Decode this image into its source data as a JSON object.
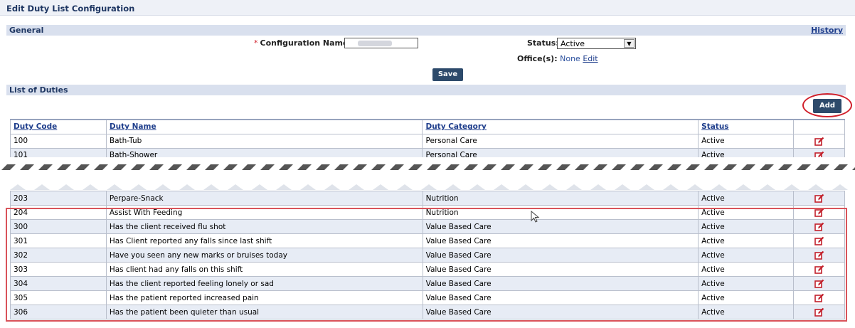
{
  "page": {
    "title": "Edit Duty List Configuration"
  },
  "general": {
    "section_label": "General",
    "history_label": "History",
    "config_name_label": "Configuration Name:",
    "required_mark": "*",
    "status_label": "Status:",
    "status_value": "Active",
    "offices_label": "Office(s):",
    "offices_value": "None",
    "offices_edit_label": "Edit",
    "save_label": "Save"
  },
  "duties": {
    "section_label": "List of Duties",
    "add_label": "Add",
    "columns": [
      "Duty Code",
      "Duty Name",
      "Duty Category",
      "Status"
    ],
    "rows_top": [
      {
        "code": "100",
        "name": "Bath-Tub",
        "category": "Personal Care",
        "status": "Active"
      },
      {
        "code": "101",
        "name": "Bath-Shower",
        "category": "Personal Care",
        "status": "Active"
      }
    ],
    "rows_bottom": [
      {
        "code": "203",
        "name": "Perpare-Snack",
        "category": "Nutrition",
        "status": "Active"
      },
      {
        "code": "204",
        "name": "Assist With Feeding",
        "category": "Nutrition",
        "status": "Active"
      },
      {
        "code": "300",
        "name": "Has the client received flu shot",
        "category": "Value Based Care",
        "status": "Active"
      },
      {
        "code": "301",
        "name": "Has Client reported any falls since last shift",
        "category": "Value Based Care",
        "status": "Active"
      },
      {
        "code": "302",
        "name": "Have you seen any new marks or bruises today",
        "category": "Value Based Care",
        "status": "Active"
      },
      {
        "code": "303",
        "name": "Has client had any falls on this shift",
        "category": "Value Based Care",
        "status": "Active"
      },
      {
        "code": "304",
        "name": "Has the client reported feeling lonely or sad",
        "category": "Value Based Care",
        "status": "Active"
      },
      {
        "code": "305",
        "name": "Has the patient reported increased pain",
        "category": "Value Based Care",
        "status": "Active"
      },
      {
        "code": "306",
        "name": "Has the patient been quieter than usual",
        "category": "Value Based Care",
        "status": "Active"
      }
    ]
  },
  "colors": {
    "accent": "#1f3e8c",
    "section_bg": "#d9e0ee",
    "button_bg": "#2d4a6b",
    "highlight_red": "#d1202b",
    "row_alt": "#e7ecf5"
  },
  "icons": {
    "edit": "edit-note-icon",
    "cursor": "mouse-pointer-icon"
  }
}
